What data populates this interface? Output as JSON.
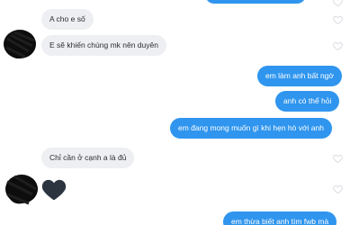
{
  "messages": [
    {
      "from": "them",
      "text": "A cho e số"
    },
    {
      "from": "them",
      "text": "E sẽ khiến chúng mk nên duyên"
    },
    {
      "from": "me",
      "text": "em làm anh bất ngờ"
    },
    {
      "from": "me",
      "text": "anh có thể hỏi"
    },
    {
      "from": "me",
      "text": "em đang mong muốn gì khi hẹn hò với anh"
    },
    {
      "from": "them",
      "text": "Chỉ cần ở cạnh a là đủ"
    },
    {
      "from": "them",
      "emoji": "black-heart"
    },
    {
      "from": "me",
      "text": "em thừa biết anh tìm fwb mà"
    }
  ],
  "colors": {
    "incoming_bubble": "#eeeff2",
    "outgoing_bubble": "#2f95ee",
    "like_icon": "#d9dbe0",
    "emoji_heart": "#2c3440"
  },
  "icons": {
    "like": "heart-outline-icon",
    "reaction": "black-heart-emoji"
  }
}
